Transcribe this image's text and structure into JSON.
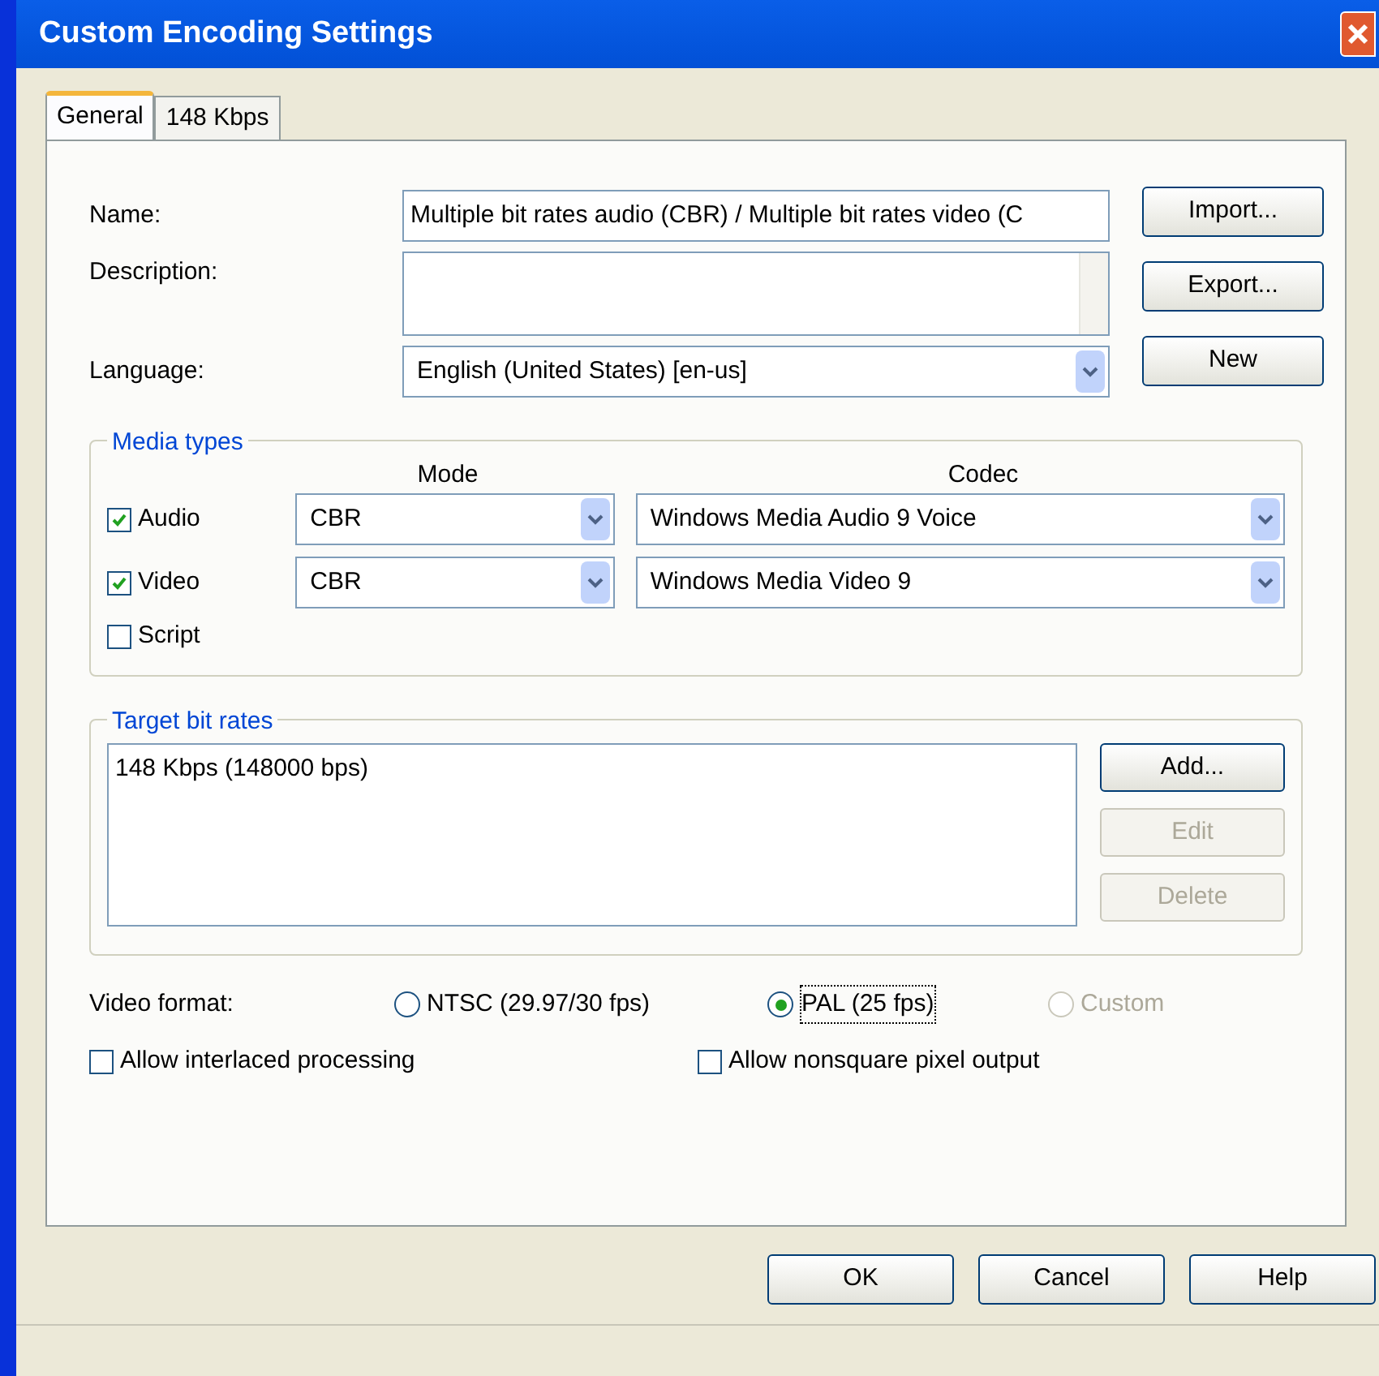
{
  "window": {
    "title": "Custom Encoding Settings"
  },
  "tabs": [
    {
      "label": "General",
      "selected": true
    },
    {
      "label": "148 Kbps",
      "selected": false
    }
  ],
  "fields": {
    "name": {
      "label": "Name:",
      "value": "Multiple bit rates audio (CBR) / Multiple bit rates video (C"
    },
    "description": {
      "label": "Description:"
    },
    "language": {
      "label": "Language:",
      "value": "English (United States) [en-us]"
    }
  },
  "side_buttons": [
    {
      "label": "Import..."
    },
    {
      "label": "Export..."
    },
    {
      "label": "New"
    }
  ],
  "media_types": {
    "title": "Media types",
    "mode_header": "Mode",
    "codec_header": "Codec",
    "rows": [
      {
        "label": "Audio",
        "checked": true,
        "mode": "CBR",
        "codec": "Windows Media Audio 9 Voice"
      },
      {
        "label": "Video",
        "checked": true,
        "mode": "CBR",
        "codec": "Windows Media Video 9"
      },
      {
        "label": "Script",
        "checked": false
      }
    ]
  },
  "target_bit_rates": {
    "title": "Target bit rates",
    "items": [
      "148 Kbps (148000 bps)"
    ],
    "buttons": [
      {
        "label": "Add...",
        "disabled": false
      },
      {
        "label": "Edit",
        "disabled": true
      },
      {
        "label": "Delete",
        "disabled": true
      }
    ]
  },
  "video_format": {
    "label": "Video format:",
    "options": [
      {
        "label": "NTSC (29.97/30 fps)",
        "selected": false,
        "disabled": false
      },
      {
        "label": "PAL (25 fps)",
        "selected": true,
        "disabled": false
      },
      {
        "label": "Custom",
        "selected": false,
        "disabled": true
      }
    ]
  },
  "options": [
    {
      "label": "Allow interlaced processing",
      "checked": false
    },
    {
      "label": "Allow nonsquare pixel output",
      "checked": false
    }
  ],
  "footer_buttons": [
    {
      "label": "OK"
    },
    {
      "label": "Cancel"
    },
    {
      "label": "Help"
    }
  ]
}
